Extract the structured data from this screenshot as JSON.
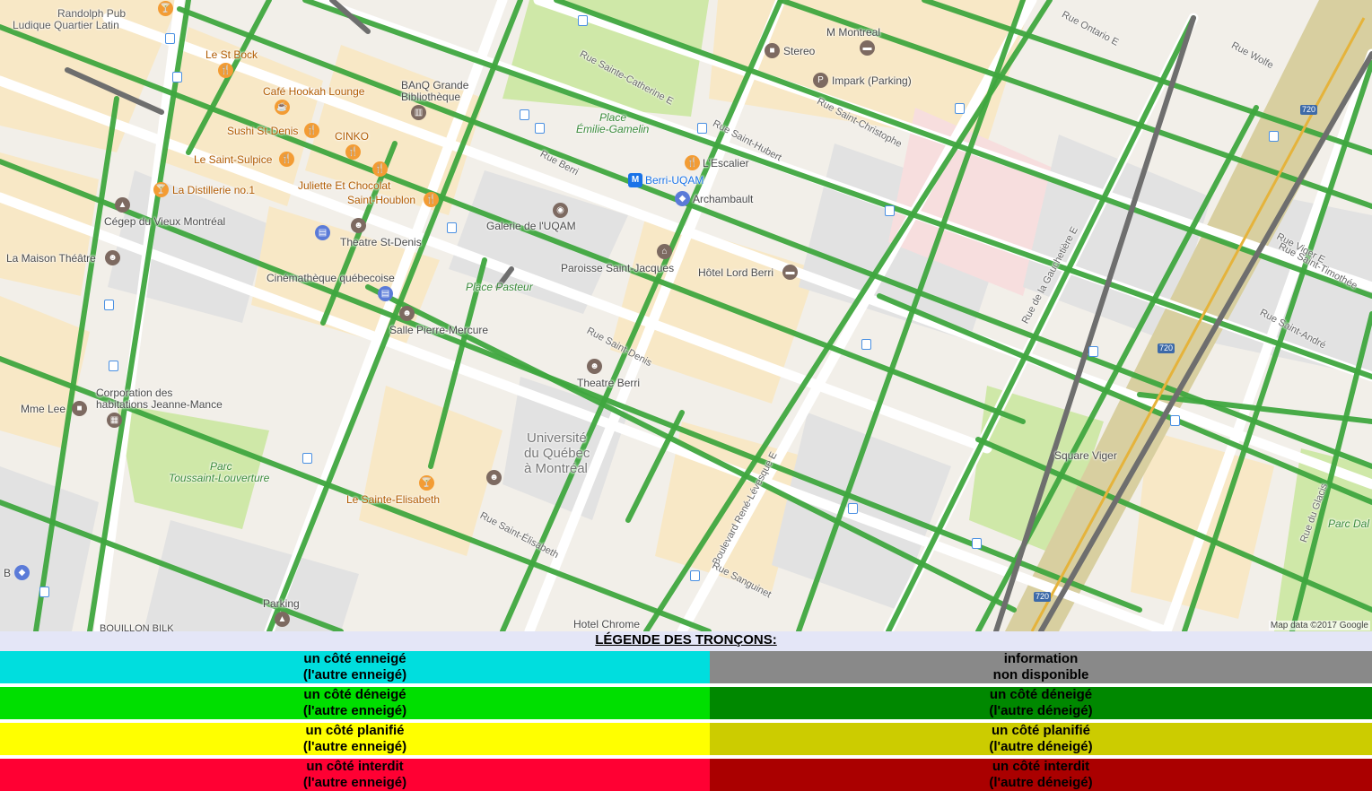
{
  "map": {
    "attribution": "Map data ©2017 Google",
    "colors": {
      "road": "#ffffff",
      "block": "#f8e8c6",
      "park": "#cfe8a8",
      "grey": "#e2e2e2",
      "snow_cleared": "#3fa63f",
      "unavailable": "#777777"
    },
    "places": [
      {
        "name": "Randolph Pub",
        "type": "text"
      },
      {
        "name": "Ludique Quartier Latin",
        "type": "text"
      },
      {
        "name": "Le St Bock",
        "type": "food"
      },
      {
        "name": "Café Hookah Lounge",
        "type": "food"
      },
      {
        "name": "Sushi St-Denis",
        "type": "food"
      },
      {
        "name": "CINKO",
        "type": "food"
      },
      {
        "name": "Le Saint-Sulpice",
        "type": "food"
      },
      {
        "name": "La Distillerie no.1",
        "type": "food"
      },
      {
        "name": "Juliette Et Chocolat",
        "type": "food"
      },
      {
        "name": "Saint-Houblon",
        "type": "food"
      },
      {
        "name": "BAnQ Grande",
        "type": "text"
      },
      {
        "name": "Bibliothèque",
        "type": "brown"
      },
      {
        "name": "Cégep du Vieux Montréal",
        "type": "brown"
      },
      {
        "name": "Theatre St-Denis",
        "type": "brown"
      },
      {
        "name": "La Maison Théâtre",
        "type": "brown"
      },
      {
        "name": "Cinémathèque québecoise",
        "type": "blue"
      },
      {
        "name": "Salle Pierre-Mercure",
        "type": "brown"
      },
      {
        "name": "Galerie de l'UQAM",
        "type": "brown"
      },
      {
        "name": "Paroisse Saint-Jacques",
        "type": "brown"
      },
      {
        "name": "Theatre Berri",
        "type": "brown"
      },
      {
        "name": "Place",
        "type": "park"
      },
      {
        "name": "Émilie-Gamelin",
        "type": "park"
      },
      {
        "name": "Place Pasteur",
        "type": "park"
      },
      {
        "name": "Berri-UQAM",
        "type": "metro"
      },
      {
        "name": "L'Escalier",
        "type": "food"
      },
      {
        "name": "Archambault",
        "type": "blue"
      },
      {
        "name": "Hôtel Lord Berri",
        "type": "brown"
      },
      {
        "name": "M Montreal",
        "type": "brown"
      },
      {
        "name": "Stereo",
        "type": "brown"
      },
      {
        "name": "Impark (Parking)",
        "type": "brown"
      },
      {
        "name": "Corporation des",
        "type": "text"
      },
      {
        "name": "habitations Jeanne-Mance",
        "type": "brown"
      },
      {
        "name": "Mme Lee",
        "type": "brown"
      },
      {
        "name": "Parc",
        "type": "park"
      },
      {
        "name": "Toussaint-Louverture",
        "type": "park"
      },
      {
        "name": "Le Sainte-Elisabeth",
        "type": "food"
      },
      {
        "name": "Université",
        "type": "big"
      },
      {
        "name": "du Québec",
        "type": "big"
      },
      {
        "name": "à Montréal",
        "type": "big"
      },
      {
        "name": "Parking",
        "type": "brown"
      },
      {
        "name": "BOUILLON BILK",
        "type": "text"
      },
      {
        "name": "Hotel Chrome",
        "type": "text"
      },
      {
        "name": "Square Viger",
        "type": "text"
      },
      {
        "name": "Parc Dal",
        "type": "park"
      },
      {
        "name": "B",
        "type": "blue"
      }
    ],
    "streets": [
      "Rue Sainte-Catherine E",
      "Rue Saint-Denis",
      "Rue Berri",
      "Rue Saint-Hubert",
      "Boulevard René-Lévesque E",
      "Rue Sanguinet",
      "Rue Saint-Christophe",
      "Rue Ontario E",
      "Rue Saint-André",
      "Rue de la Gauchetière E",
      "Rue Viger E",
      "Rue Saint-Timothée",
      "Rue Wolfe",
      "Rue du Glacis",
      "Rue Saint-Élisabeth"
    ],
    "highway_shields": [
      "720",
      "720",
      "720"
    ]
  },
  "legend": {
    "title": "LÉGENDE DES TRONÇONS:",
    "rows": [
      {
        "left": {
          "line1": "un côté enneigé",
          "line2": "(l'autre enneigé)",
          "color": "#00dede"
        },
        "right": {
          "line1": "information",
          "line2": "non disponible",
          "color": "#898989"
        }
      },
      {
        "left": {
          "line1": "un côté déneigé",
          "line2": "(l'autre enneigé)",
          "color": "#00df00"
        },
        "right": {
          "line1": "un côté déneigé",
          "line2": "(l'autre déneigé)",
          "color": "#008800"
        }
      },
      {
        "left": {
          "line1": "un côté planifié",
          "line2": "(l'autre enneigé)",
          "color": "#ffff00"
        },
        "right": {
          "line1": "un côté planifié",
          "line2": "(l'autre déneigé)",
          "color": "#cccc00"
        }
      },
      {
        "left": {
          "line1": "un côté interdit",
          "line2": "(l'autre enneigé)",
          "color": "#ff0033"
        },
        "right": {
          "line1": "un côté interdit",
          "line2": "(l'autre déneigé)",
          "color": "#aa0000"
        }
      }
    ]
  }
}
